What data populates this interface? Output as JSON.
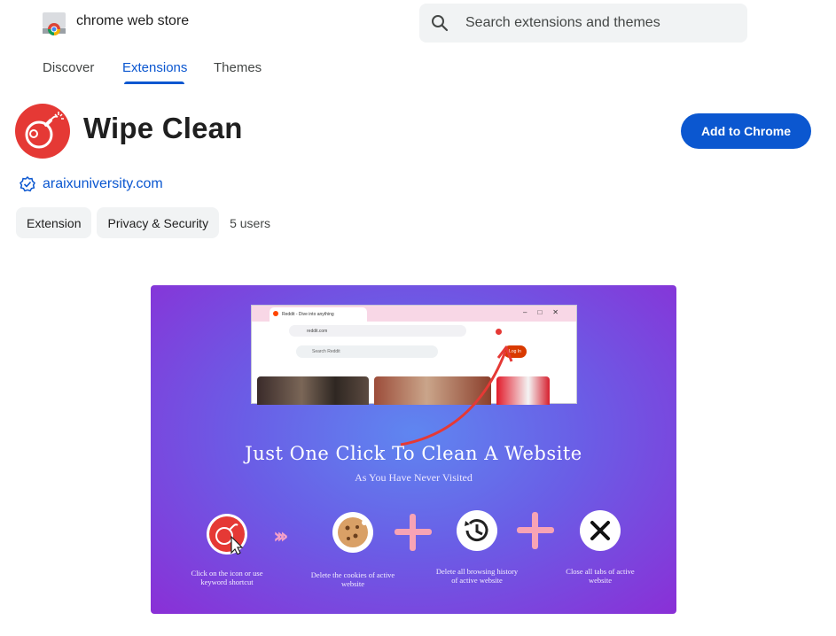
{
  "header": {
    "store_name": "chrome web store",
    "search_placeholder": "Search extensions and themes"
  },
  "nav": {
    "tabs": [
      {
        "label": "Discover",
        "active": false
      },
      {
        "label": "Extensions",
        "active": true
      },
      {
        "label": "Themes",
        "active": false
      }
    ]
  },
  "extension": {
    "name": "Wipe Clean",
    "add_button": "Add to Chrome",
    "publisher": "araixuniversity.com",
    "chips": [
      "Extension",
      "Privacy & Security"
    ],
    "users": "5 users"
  },
  "screenshot": {
    "mini_browser": {
      "tab_title": "Reddit - Dive into anything",
      "url": "reddit.com",
      "search": "Search Reddit",
      "login": "Log In"
    },
    "title": "Just One Click To Clean A Website",
    "subtitle": "As You Have Never Visited",
    "steps": [
      {
        "label": "Click on the icon or use keyword shortcut"
      },
      {
        "label": "Delete the cookies of active website"
      },
      {
        "label": "Delete all browsing history of active website"
      },
      {
        "label": "Close all tabs of active website"
      }
    ]
  },
  "colors": {
    "accent": "#0b57d0",
    "brand_red": "#e53935",
    "chip_bg": "#f1f3f4"
  }
}
